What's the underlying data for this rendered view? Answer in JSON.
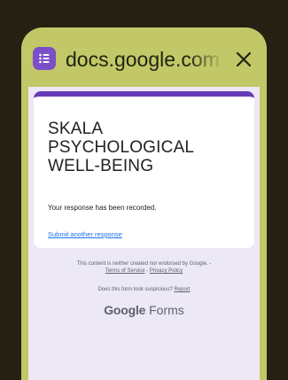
{
  "tab": {
    "url": "docs.google.com",
    "app_icon": "google-forms-icon",
    "close_icon": "close-icon",
    "accent": "#c2c768"
  },
  "form": {
    "title": "SKALA PSYCHOLOGICAL WELL-BEING",
    "confirmation": "Your response has been recorded.",
    "submit_another": "Submit another response",
    "header_color": "#673ab7"
  },
  "footer": {
    "disclaimer_prefix": "This content is neither created nor endorsed by Google. -",
    "terms": "Terms of Service",
    "separator": " - ",
    "privacy": "Privacy Policy",
    "suspicious_prefix": "Does this form look suspicious?",
    "report": "Report",
    "brand_google": "Google",
    "brand_forms": "Forms"
  }
}
